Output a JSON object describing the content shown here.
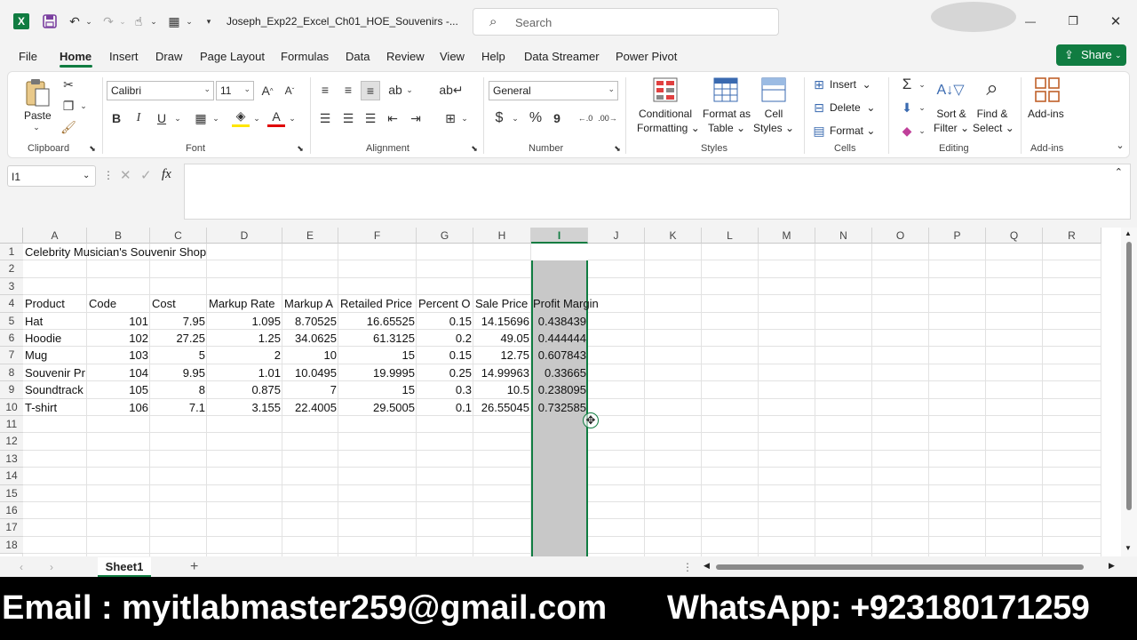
{
  "titlebar": {
    "app_icon": "excel-icon",
    "filename": "Joseph_Exp22_Excel_Ch01_HOE_Souvenirs  -...",
    "search_placeholder": "Search",
    "min": "—",
    "restore": "❐",
    "close": "✕"
  },
  "tabs": [
    "File",
    "Home",
    "Insert",
    "Draw",
    "Page Layout",
    "Formulas",
    "Data",
    "Review",
    "View",
    "Help",
    "Data Streamer",
    "Power Pivot"
  ],
  "share_label": "Share",
  "ribbon": {
    "clipboard": {
      "paste": "Paste",
      "label": "Clipboard"
    },
    "font": {
      "name": "Calibri",
      "size": "11",
      "label": "Font",
      "bold": "B",
      "italic": "I",
      "underline": "U"
    },
    "alignment": {
      "label": "Alignment"
    },
    "number": {
      "format": "General",
      "label": "Number",
      "currency": "$",
      "percent": "%",
      "comma": "9"
    },
    "styles": {
      "cond1": "Conditional",
      "cond2": "Formatting",
      "fmt1": "Format as",
      "fmt2": "Table",
      "cell1": "Cell",
      "cell2": "Styles",
      "label": "Styles"
    },
    "cells": {
      "insert": "Insert",
      "delete": "Delete",
      "format": "Format",
      "label": "Cells"
    },
    "editing": {
      "sort1": "Sort &",
      "sort2": "Filter",
      "find1": "Find &",
      "find2": "Select",
      "label": "Editing"
    },
    "addins": {
      "btn": "Add-ins",
      "label": "Add-ins"
    }
  },
  "formula_bar": {
    "name_box": "I1",
    "fx": "fx",
    "value": ""
  },
  "columns": [
    "A",
    "B",
    "C",
    "D",
    "E",
    "F",
    "G",
    "H",
    "I",
    "J",
    "K",
    "L",
    "M",
    "N",
    "O",
    "P",
    "Q",
    "R"
  ],
  "rows": [
    "1",
    "2",
    "3",
    "4",
    "5",
    "6",
    "7",
    "8",
    "9",
    "10",
    "11",
    "12",
    "13",
    "14",
    "15",
    "16",
    "17",
    "18"
  ],
  "sheet": {
    "title": "Celebrity Musician's Souvenir Shop",
    "headers": [
      "Product",
      "Code",
      "Cost",
      "Markup Rate",
      "Markup A",
      "Retailed Price",
      "Percent O",
      "Sale Price",
      "Profit Margin"
    ],
    "data": [
      [
        "Hat",
        "101",
        "7.95",
        "1.095",
        "8.70525",
        "16.65525",
        "0.15",
        "14.15696",
        "0.438439"
      ],
      [
        "Hoodie",
        "102",
        "27.25",
        "1.25",
        "34.0625",
        "61.3125",
        "0.2",
        "49.05",
        "0.444444"
      ],
      [
        "Mug",
        "103",
        "5",
        "2",
        "10",
        "15",
        "0.15",
        "12.75",
        "0.607843"
      ],
      [
        "Souvenir Pr",
        "104",
        "9.95",
        "1.01",
        "10.0495",
        "19.9995",
        "0.25",
        "14.99963",
        "0.33665"
      ],
      [
        "Soundtrack",
        "105",
        "8",
        "0.875",
        "7",
        "15",
        "0.3",
        "10.5",
        "0.238095"
      ],
      [
        "T-shirt",
        "106",
        "7.1",
        "3.155",
        "22.4005",
        "29.5005",
        "0.1",
        "26.55045",
        "0.732585"
      ]
    ]
  },
  "sheet_tab": "Sheet1",
  "add_sheet": "+",
  "banner": {
    "email": "Email : myitlabmaster259@gmail.com",
    "whatsapp": "WhatsApp: +923180171259"
  },
  "colors": {
    "accent": "#107c41",
    "selection": "#c8c8c8",
    "banner_bg": "#000000"
  }
}
